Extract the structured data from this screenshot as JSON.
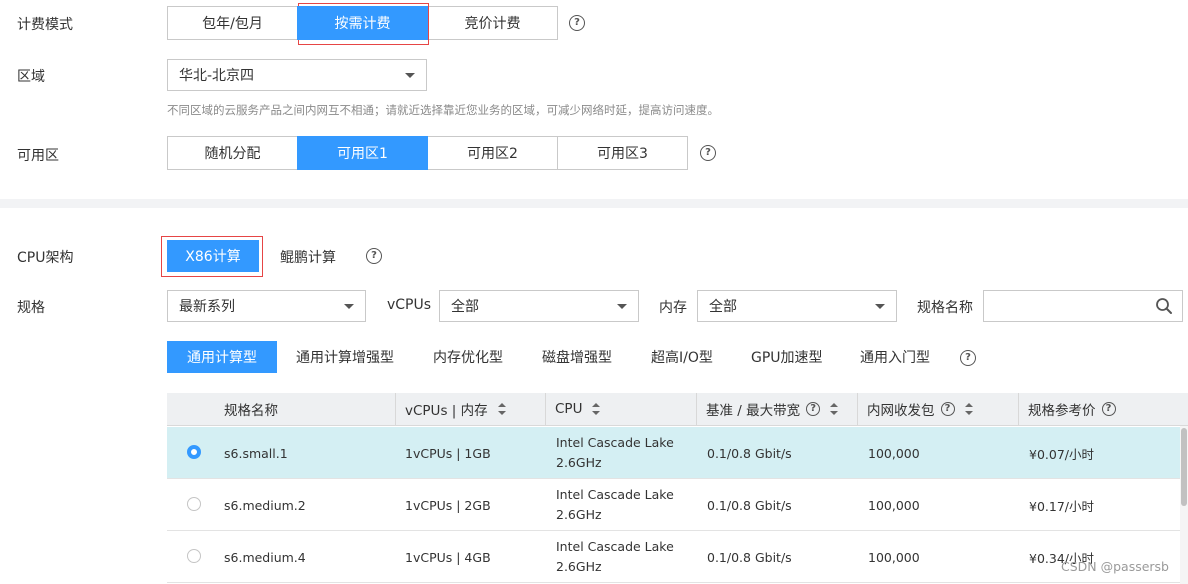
{
  "billing": {
    "label": "计费模式",
    "options": [
      "包年/包月",
      "按需计费",
      "竞价计费"
    ],
    "selected": "按需计费"
  },
  "region": {
    "label": "区域",
    "value": "华北-北京四",
    "hint": "不同区域的云服务产品之间内网互不相通；请就近选择靠近您业务的区域，可减少网络时延，提高访问速度。"
  },
  "az": {
    "label": "可用区",
    "options": [
      "随机分配",
      "可用区1",
      "可用区2",
      "可用区3"
    ],
    "selected": "可用区1"
  },
  "cpu_arch": {
    "label": "CPU架构",
    "options": [
      "X86计算",
      "鲲鹏计算"
    ],
    "selected": "X86计算"
  },
  "spec": {
    "label": "规格",
    "series_value": "最新系列",
    "vcpus_label": "vCPUs",
    "vcpus_value": "全部",
    "memory_label": "内存",
    "memory_value": "全部",
    "name_label": "规格名称",
    "name_placeholder": ""
  },
  "tabs": {
    "items": [
      "通用计算型",
      "通用计算增强型",
      "内存优化型",
      "磁盘增强型",
      "超高I/O型",
      "GPU加速型",
      "通用入门型"
    ],
    "active": "通用计算型"
  },
  "table": {
    "headers": {
      "name": "规格名称",
      "vcpus_mem": "vCPUs | 内存",
      "cpu": "CPU",
      "bandwidth": "基准 / 最大带宽",
      "pps": "内网收发包",
      "price": "规格参考价"
    },
    "rows": [
      {
        "name": "s6.small.1",
        "vcpus_mem": "1vCPUs | 1GB",
        "cpu_line1": "Intel Cascade Lake",
        "cpu_line2": "2.6GHz",
        "bandwidth": "0.1/0.8 Gbit/s",
        "pps": "100,000",
        "price": "¥0.07/小时",
        "selected": true
      },
      {
        "name": "s6.medium.2",
        "vcpus_mem": "1vCPUs | 2GB",
        "cpu_line1": "Intel Cascade Lake",
        "cpu_line2": "2.6GHz",
        "bandwidth": "0.1/0.8 Gbit/s",
        "pps": "100,000",
        "price": "¥0.17/小时",
        "selected": false
      },
      {
        "name": "s6.medium.4",
        "vcpus_mem": "1vCPUs | 4GB",
        "cpu_line1": "Intel Cascade Lake",
        "cpu_line2": "2.6GHz",
        "bandwidth": "0.1/0.8 Gbit/s",
        "pps": "100,000",
        "price": "¥0.34/小时",
        "selected": false
      }
    ]
  },
  "watermark": "CSDN @passersb",
  "colors": {
    "accent": "#3399ff",
    "highlight_border": "#e64545",
    "selected_row": "#d4eff3"
  },
  "icons": {
    "help": "question-circle-icon",
    "search": "search-icon",
    "dropdown": "caret-down-icon"
  }
}
